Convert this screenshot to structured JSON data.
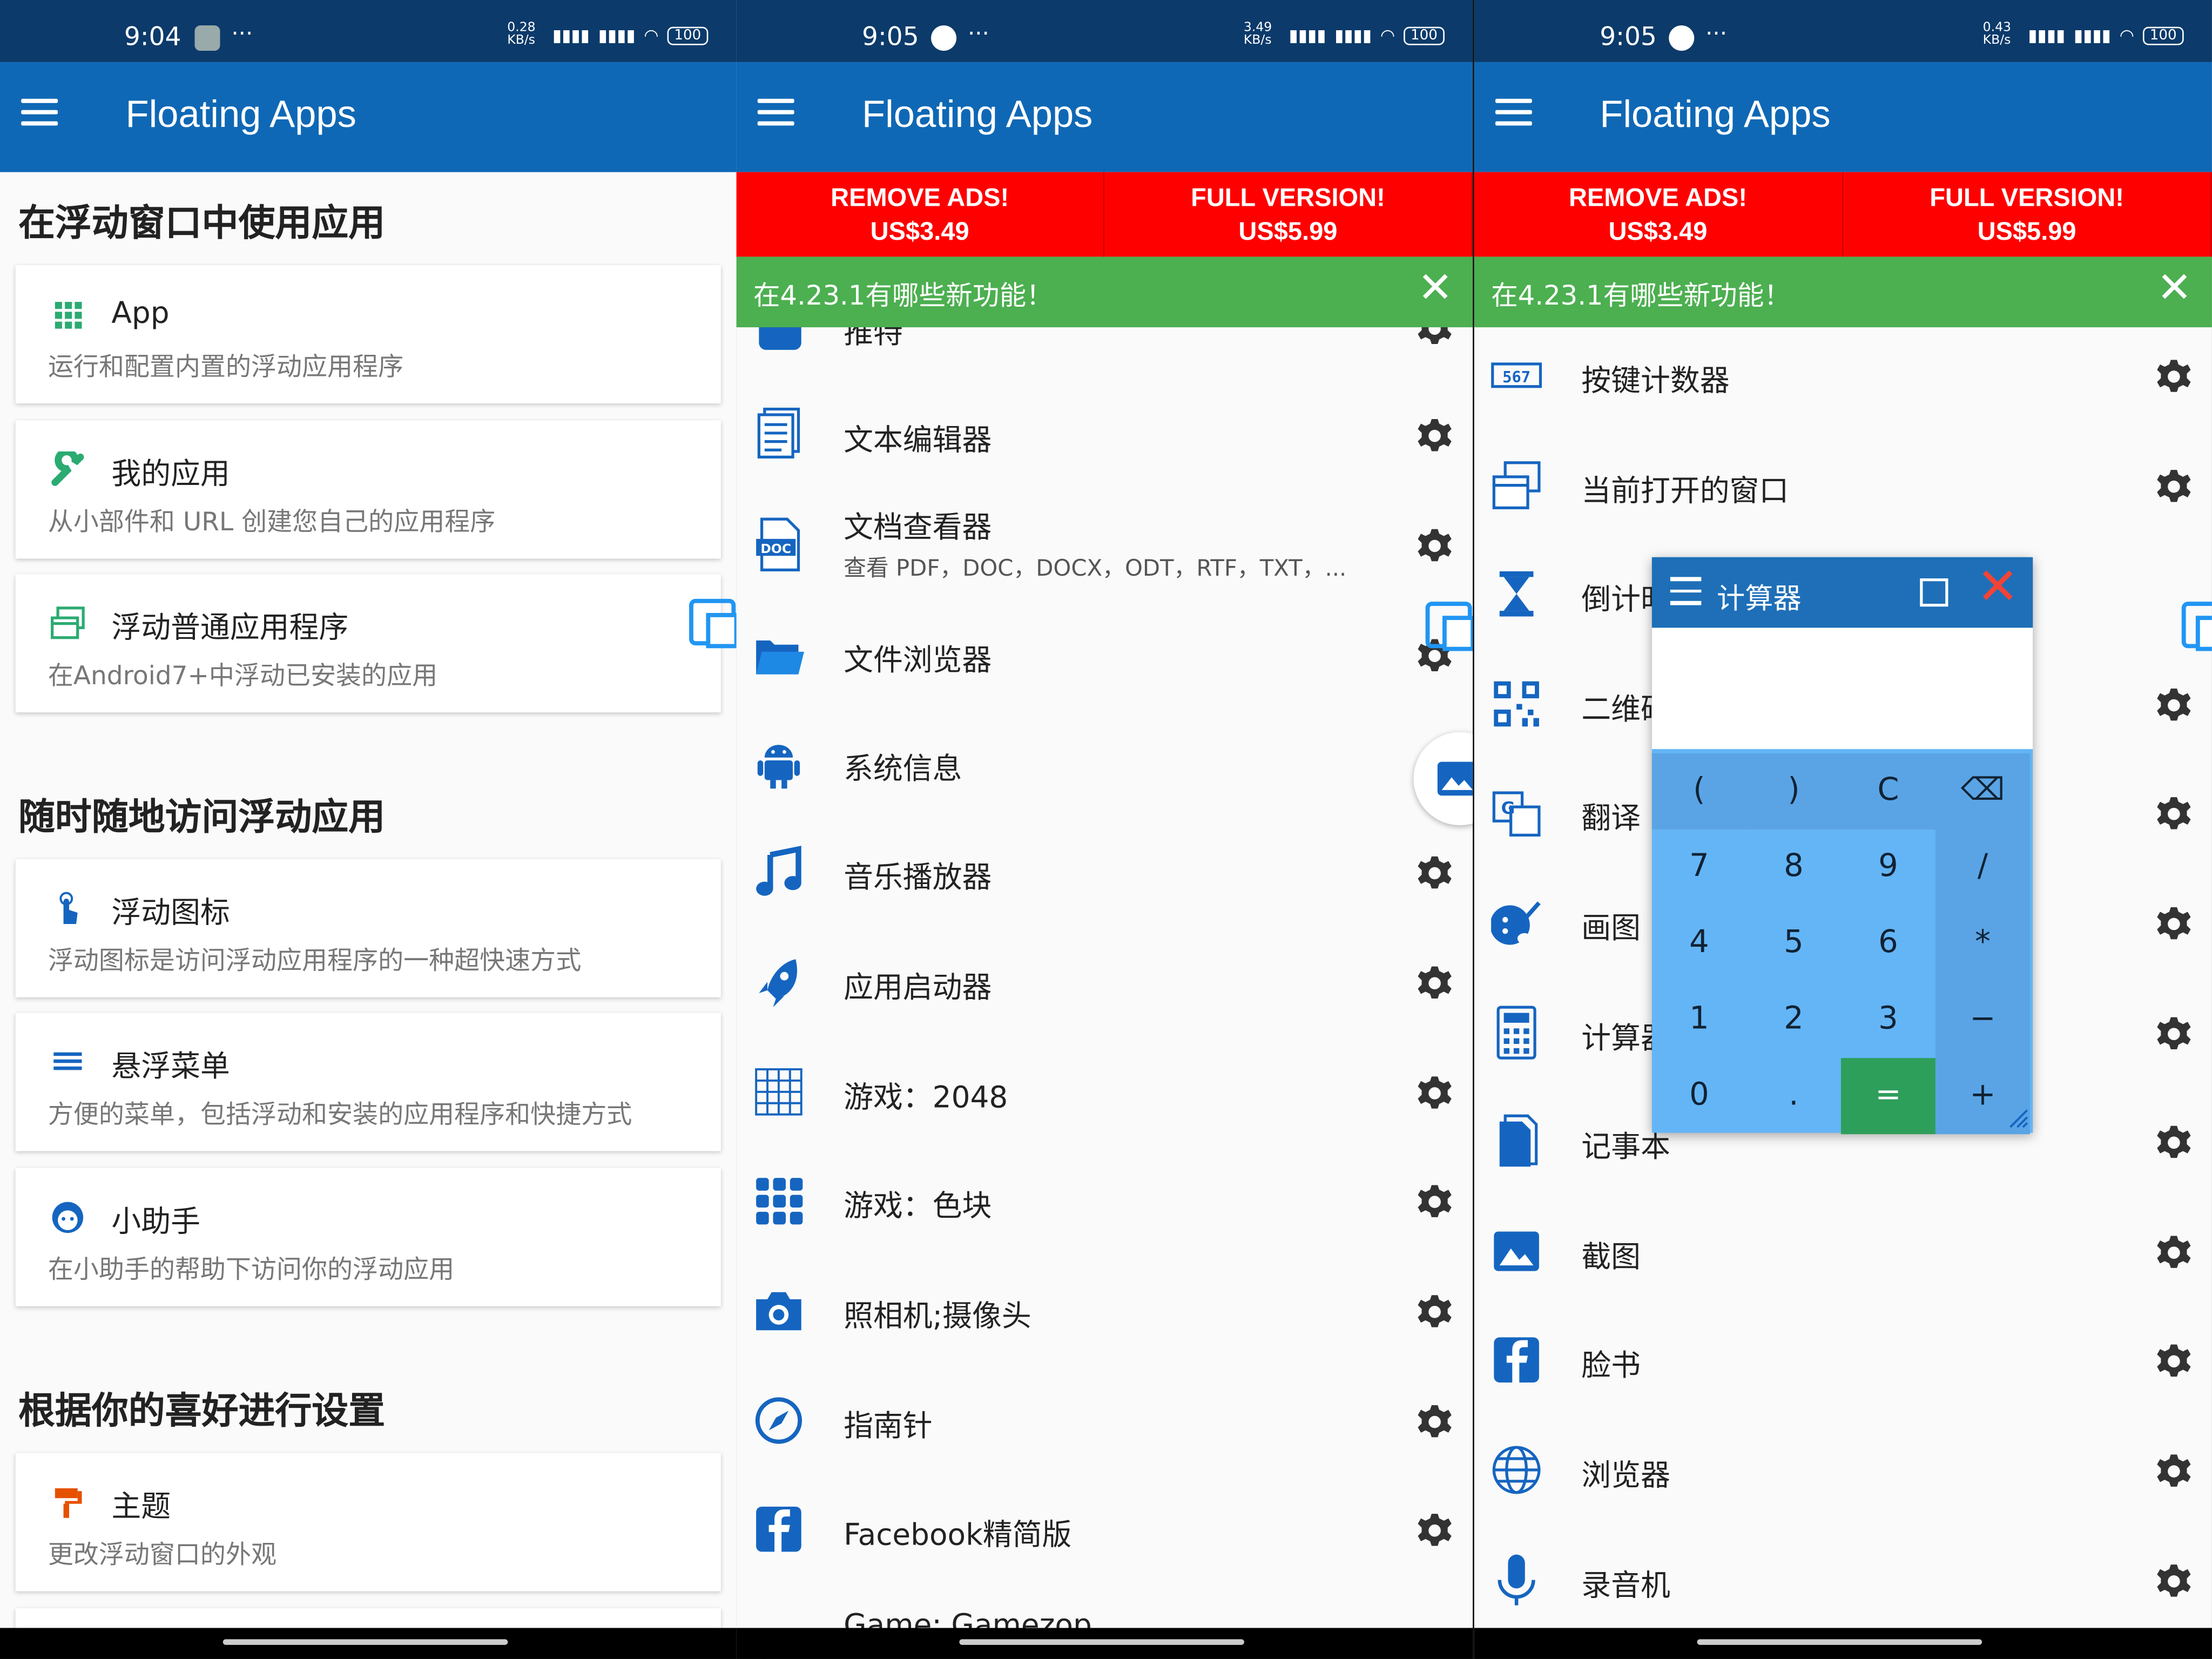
{
  "colors": {
    "status_bar": "#0c3a6a",
    "app_bar": "#0f68b5",
    "promo": "#ff0000",
    "whats_new": "#4caf50",
    "icon_blue": "#1565c0",
    "calc_key": "#64b5f6",
    "calc_equals": "#2e9e5b"
  },
  "screens": [
    {
      "status": {
        "time": "9:04",
        "speed": "0.28 KB/s",
        "battery": "100"
      }
    },
    {
      "status": {
        "time": "9:05",
        "speed": "3.49 KB/s",
        "battery": "100"
      }
    },
    {
      "status": {
        "time": "9:05",
        "speed": "0.43 KB/s",
        "battery": "100"
      }
    }
  ],
  "app_title": "Floating Apps",
  "promo": {
    "remove_ads": "REMOVE ADS!",
    "remove_ads_price": "US$3.49",
    "full_version": "FULL VERSION!",
    "full_version_price": "US$5.99"
  },
  "whats_new": "在4.23.1有哪些新功能！",
  "screen1": {
    "sections": [
      "在浮动窗口中使用应用",
      "随时随地访问浮动应用",
      "根据你的喜好进行设置"
    ],
    "cards": [
      {
        "icon": "grid-icon",
        "title": "App",
        "subtitle": "运行和配置内置的浮动应用程序"
      },
      {
        "icon": "wrench-icon",
        "title": "我的应用",
        "subtitle": "从小部件和 URL 创建您自己的应用程序"
      },
      {
        "icon": "windows-icon",
        "title": "浮动普通应用程序",
        "subtitle": "在Android7+中浮动已安装的应用"
      },
      {
        "icon": "touch-icon",
        "title": "浮动图标",
        "subtitle": "浮动图标是访问浮动应用程序的一种超快速方式"
      },
      {
        "icon": "menu-icon",
        "title": "悬浮菜单",
        "subtitle": "方便的菜单，包括浮动和安装的应用程序和快捷方式"
      },
      {
        "icon": "face-icon",
        "title": "小助手",
        "subtitle": "在小助手的帮助下访问你的浮动应用"
      },
      {
        "icon": "paint-roller-icon",
        "title": "主题",
        "subtitle": "更改浮动窗口的外观"
      }
    ]
  },
  "screen2": {
    "items": [
      {
        "icon": "twitter-icon",
        "title": "推特"
      },
      {
        "icon": "text-document-icon",
        "title": "文本编辑器"
      },
      {
        "icon": "doc-file-icon",
        "title": "文档查看器",
        "subtitle": "查看 PDF，DOC，DOCX，ODT，RTF，TXT，..."
      },
      {
        "icon": "folder-icon",
        "title": "文件浏览器"
      },
      {
        "icon": "android-icon",
        "title": "系统信息"
      },
      {
        "icon": "music-note-icon",
        "title": "音乐播放器"
      },
      {
        "icon": "rocket-icon",
        "title": "应用启动器"
      },
      {
        "icon": "game-grid-icon",
        "title": "游戏：2048"
      },
      {
        "icon": "color-blocks-icon",
        "title": "游戏：色块"
      },
      {
        "icon": "camera-icon",
        "title": "照相机;摄像头"
      },
      {
        "icon": "compass-icon",
        "title": "指南针"
      },
      {
        "icon": "facebook-icon",
        "title": "Facebook精简版"
      },
      {
        "icon": "game-icon",
        "title": "Game: Gamezop"
      }
    ]
  },
  "screen3": {
    "items": [
      {
        "icon": "counter-icon",
        "title": "按键计数器"
      },
      {
        "icon": "open-windows-icon",
        "title": "当前打开的窗口"
      },
      {
        "icon": "hourglass-icon",
        "title": "倒计时"
      },
      {
        "icon": "qr-code-icon",
        "title": "二维码"
      },
      {
        "icon": "translate-icon",
        "title": "翻译"
      },
      {
        "icon": "palette-icon",
        "title": "画图"
      },
      {
        "icon": "calculator-icon",
        "title": "计算器"
      },
      {
        "icon": "notepad-icon",
        "title": "记事本"
      },
      {
        "icon": "image-icon",
        "title": "截图"
      },
      {
        "icon": "facebook-icon",
        "title": "脸书"
      },
      {
        "icon": "globe-icon",
        "title": "浏览器"
      },
      {
        "icon": "microphone-icon",
        "title": "录音机"
      }
    ]
  },
  "calculator": {
    "title": "计算器",
    "keys": [
      "(",
      ")",
      "C",
      "⌫",
      "7",
      "8",
      "9",
      "/",
      "4",
      "5",
      "6",
      "*",
      "1",
      "2",
      "3",
      "−",
      "0",
      ".",
      "=",
      "+"
    ]
  }
}
